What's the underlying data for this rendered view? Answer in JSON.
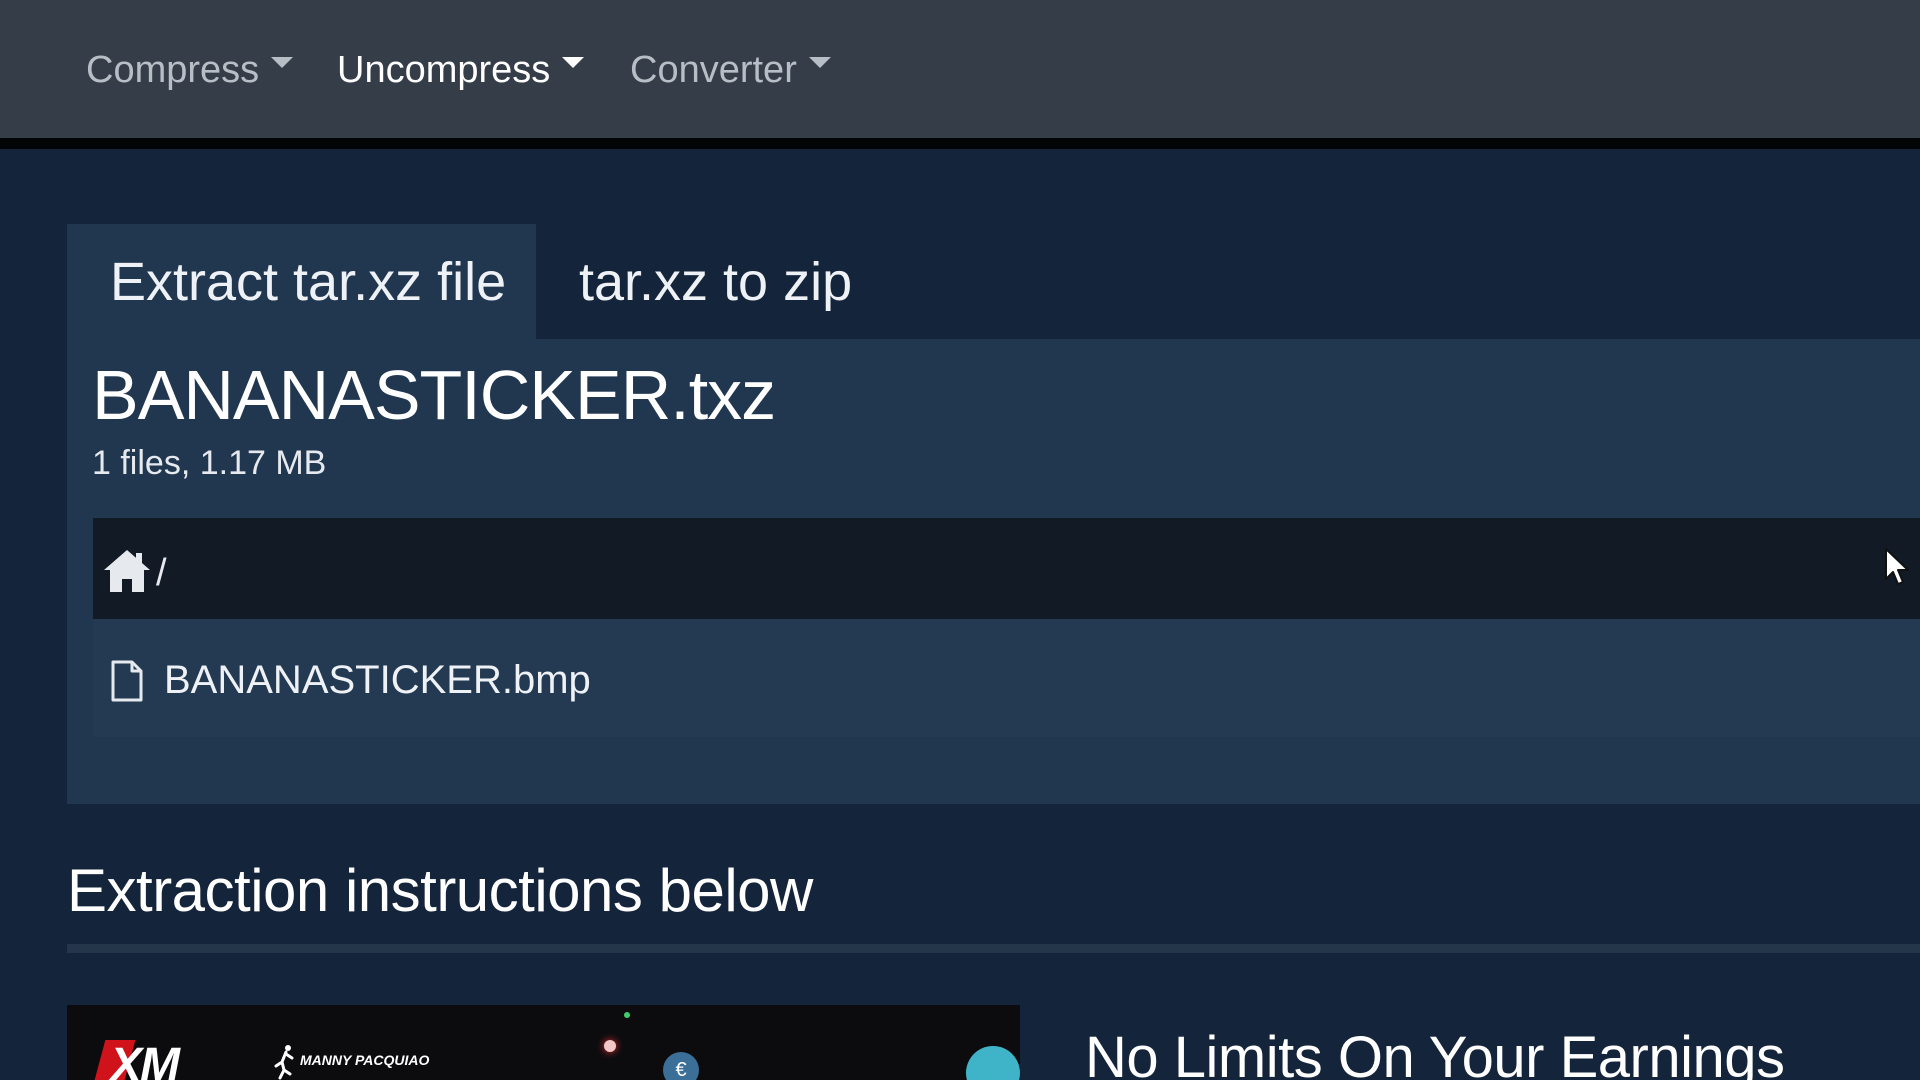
{
  "nav": {
    "items": [
      {
        "label": "Compress",
        "active": false
      },
      {
        "label": "Uncompress",
        "active": true
      },
      {
        "label": "Converter",
        "active": false
      }
    ]
  },
  "tabs": [
    {
      "label": "Extract tar.xz file",
      "active": true
    },
    {
      "label": "tar.xz to zip",
      "active": false
    }
  ],
  "archive": {
    "name": "BANANASTICKER.txz",
    "meta": "1 files, 1.17 MB",
    "path": "/",
    "files": [
      {
        "name": "BANANASTICKER.bmp",
        "icon": "file-icon"
      }
    ]
  },
  "instructions_heading": "Extraction instructions below",
  "ad": {
    "logo": "XM",
    "sub_label": "MANNY PACQUIAO",
    "euro_symbol": "€",
    "headline": "No Limits On Your Earnings"
  },
  "colors": {
    "navbar": "#353e48",
    "background": "#14243a",
    "panel": "#213750",
    "pathbar": "#111a25"
  }
}
